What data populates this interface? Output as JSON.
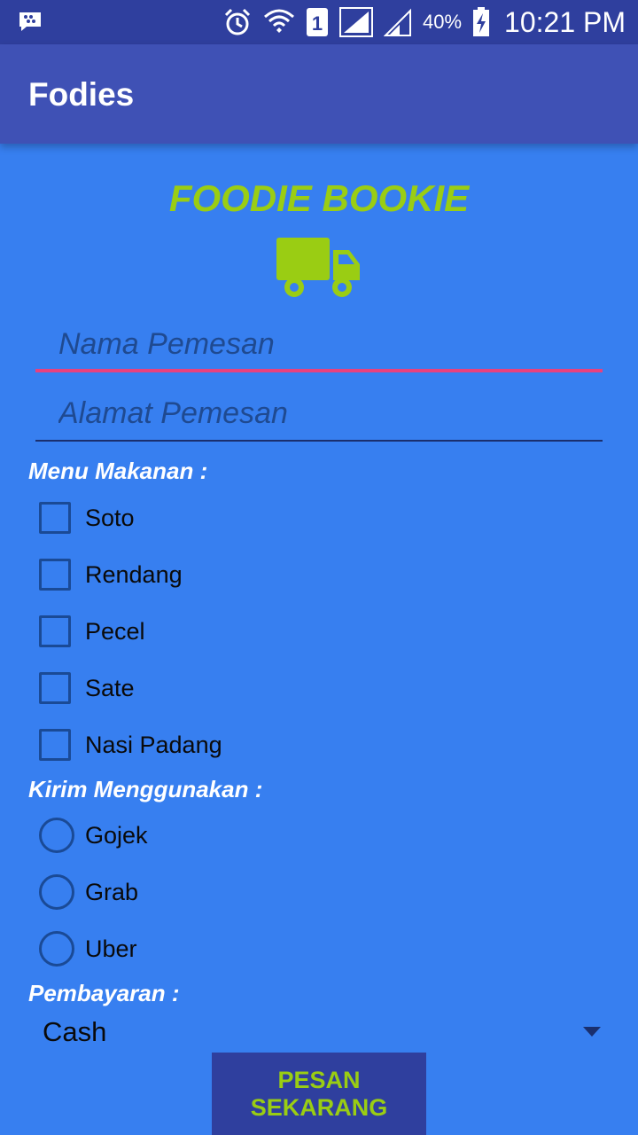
{
  "status_bar": {
    "battery_percent": "40%",
    "time": "10:21 PM",
    "sim_slot": "1",
    "icons": [
      "bbm-icon",
      "alarm-icon",
      "wifi-icon",
      "sim-icon",
      "signal-icon",
      "signal-icon",
      "battery-charging-icon"
    ]
  },
  "app_bar": {
    "title": "Fodies"
  },
  "brand": {
    "title": "FOODIE BOOKIE",
    "icon": "truck-icon"
  },
  "form": {
    "name_placeholder": "Nama Pemesan",
    "address_placeholder": "Alamat Pemesan",
    "menu_label": "Menu Makanan :",
    "menu_items": [
      {
        "label": "Soto",
        "checked": false
      },
      {
        "label": "Rendang",
        "checked": false
      },
      {
        "label": "Pecel",
        "checked": false
      },
      {
        "label": "Sate",
        "checked": false
      },
      {
        "label": "Nasi Padang",
        "checked": false
      }
    ],
    "delivery_label": "Kirim Menggunakan :",
    "delivery_options": [
      {
        "label": "Gojek",
        "selected": false
      },
      {
        "label": "Grab",
        "selected": false
      },
      {
        "label": "Uber",
        "selected": false
      }
    ],
    "payment_label": "Pembayaran :",
    "payment_selected": "Cash",
    "submit_label": "PESAN SEKARANG"
  },
  "colors": {
    "background": "#377ff0",
    "status_bar": "#2f3f9e",
    "app_bar": "#3f51b5",
    "accent_green": "#9acd13",
    "focus_pink": "#e8417e",
    "control_blue": "#1a4a96"
  }
}
